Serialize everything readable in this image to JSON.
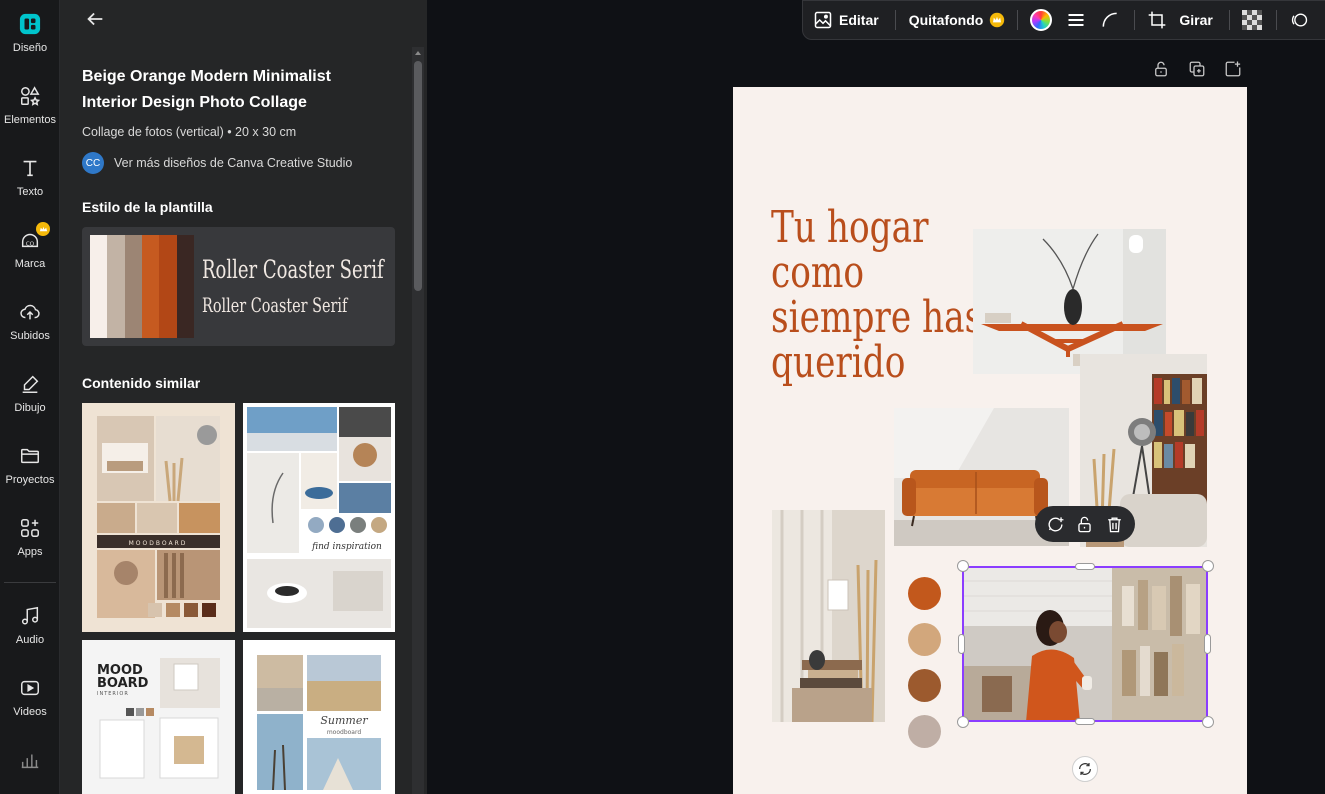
{
  "rail": {
    "items": [
      {
        "label": "Diseño"
      },
      {
        "label": "Elementos"
      },
      {
        "label": "Texto"
      },
      {
        "label": "Marca"
      },
      {
        "label": "Subidos"
      },
      {
        "label": "Dibujo"
      },
      {
        "label": "Proyectos"
      },
      {
        "label": "Apps"
      },
      {
        "label": "Audio"
      },
      {
        "label": "Videos"
      }
    ],
    "active_color": "#00c4cc"
  },
  "panel": {
    "template_title": "Beige Orange Modern Minimalist Interior Design Photo Collage",
    "template_meta": "Collage de fotos (vertical) • 20 x 30 cm",
    "author_initials": "CC",
    "author_link": "Ver más diseños de Canva Creative Studio",
    "style_heading": "Estilo de la plantilla",
    "palette": [
      "#f7efea",
      "#c2b3a5",
      "#9c8574",
      "#c65a20",
      "#b24716",
      "#3a2723"
    ],
    "font_sample_1": "Roller Coaster Serif",
    "font_sample_2": "Roller Coaster Serif",
    "similar_heading": "Contenido similar",
    "thumb_1_label": "MOODBOARD",
    "thumb_2_label": "find inspiration",
    "thumb_3_title_1": "MOOD",
    "thumb_3_title_2": "BOARD",
    "thumb_3_subtitle": "INTERIOR",
    "thumb_4_script": "Summer",
    "thumb_4_sub": "moodboard"
  },
  "toolbar": {
    "edit_label": "Editar",
    "bg_remove_label": "Quitafondo",
    "rotate_label": "Girar"
  },
  "design": {
    "headline_lines": [
      "Tu hogar",
      "como",
      "siempre has",
      "querido"
    ],
    "headline_color": "#b94e1c",
    "swatches": [
      "#c2581c",
      "#d2a77c",
      "#9c5a2e",
      "#bfaea5"
    ],
    "selection_color": "#8b3dff"
  }
}
